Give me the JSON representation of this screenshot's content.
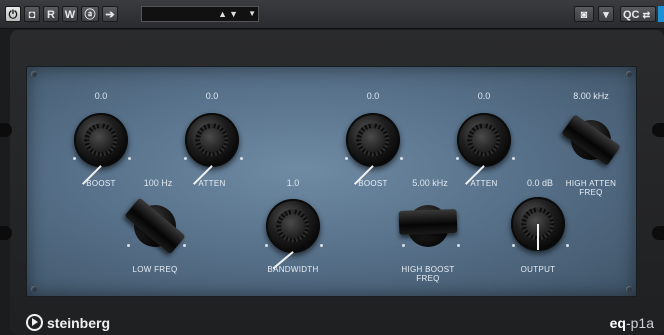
{
  "toolbar": {
    "power_icon": "power-icon",
    "bypass_icon": "bypass-icon",
    "read_label": "R",
    "write_label": "W",
    "compare_icon": "compare-icon",
    "arrow_icon": "arrow-right-icon",
    "preset_value": "",
    "snapshot_icon": "camera-icon",
    "qc_label": "QC",
    "accent_color": "#1e90d6"
  },
  "controls": {
    "low_boost": {
      "label": "BOOST",
      "value": "0.0"
    },
    "low_atten": {
      "label": "ATTEN",
      "value": "0.0"
    },
    "high_boost": {
      "label": "BOOST",
      "value": "0.0"
    },
    "high_atten": {
      "label": "ATTEN",
      "value": "0.0"
    },
    "high_atten_freq": {
      "label_line1": "HIGH ATTEN",
      "label_line2": "FREQ",
      "value": "8.00 kHz"
    },
    "low_freq": {
      "label": "LOW FREQ",
      "value": "100 Hz"
    },
    "bandwidth": {
      "label": "BANDWIDTH",
      "value": "1.0"
    },
    "high_boost_freq": {
      "label_line1": "HIGH BOOST",
      "label_line2": "FREQ",
      "value": "5.00 kHz"
    },
    "output": {
      "label": "OUTPUT",
      "value": "0.0 dB"
    }
  },
  "footer": {
    "brand": "steinberg",
    "plugin_prefix": "eq",
    "plugin_suffix": "-p1a"
  }
}
